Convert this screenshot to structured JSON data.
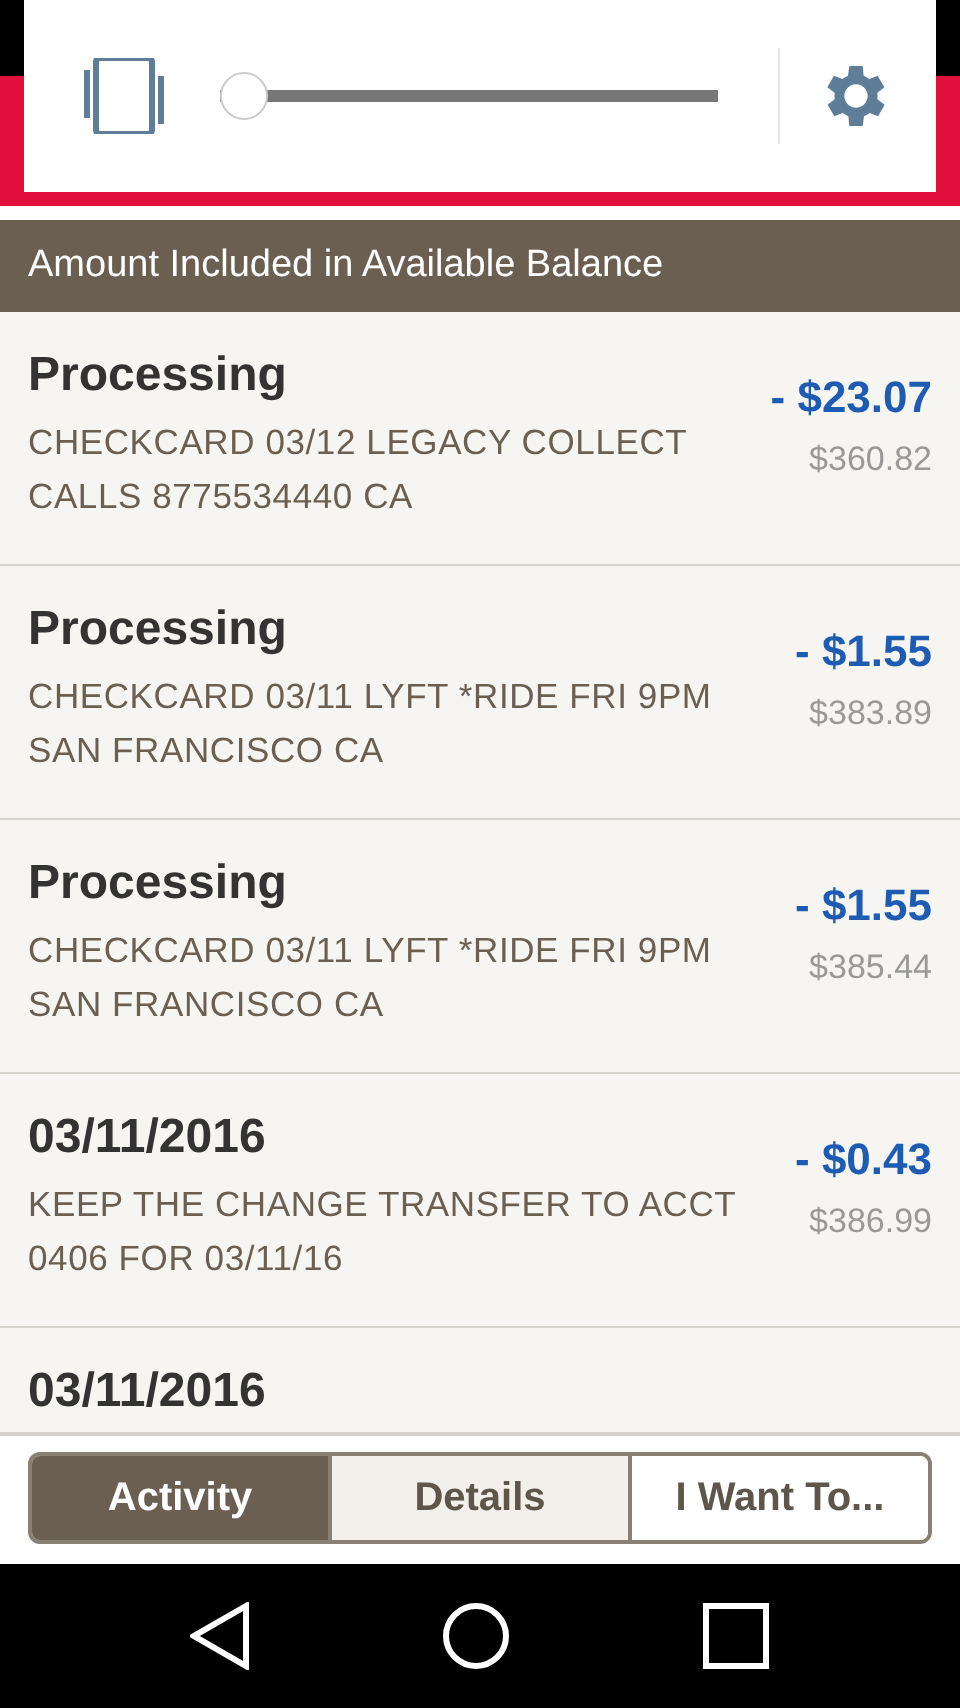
{
  "volume_panel": {
    "level": 0.0
  },
  "section_header": "Amount Included in Available Balance",
  "transactions": [
    {
      "title": "Processing",
      "description": "CHECKCARD 03/12 LEGACY COLLECT CALLS 8775534440 CA",
      "amount": "- $23.07",
      "balance": "$360.82"
    },
    {
      "title": "Processing",
      "description": "CHECKCARD 03/11 LYFT *RIDE FRI 9PM SAN FRANCISCO CA",
      "amount": "- $1.55",
      "balance": "$383.89"
    },
    {
      "title": "Processing",
      "description": "CHECKCARD 03/11 LYFT *RIDE FRI 9PM SAN FRANCISCO CA",
      "amount": "- $1.55",
      "balance": "$385.44"
    },
    {
      "title": "03/11/2016",
      "description": "KEEP THE CHANGE TRANSFER TO ACCT 0406 FOR 03/11/16",
      "amount": "- $0.43",
      "balance": "$386.99"
    },
    {
      "title": "03/11/2016"
    }
  ],
  "tabs": [
    {
      "label": "Activity",
      "selected": true
    },
    {
      "label": "Details",
      "selected": false
    },
    {
      "label": "I Want To...",
      "selected": false
    }
  ]
}
